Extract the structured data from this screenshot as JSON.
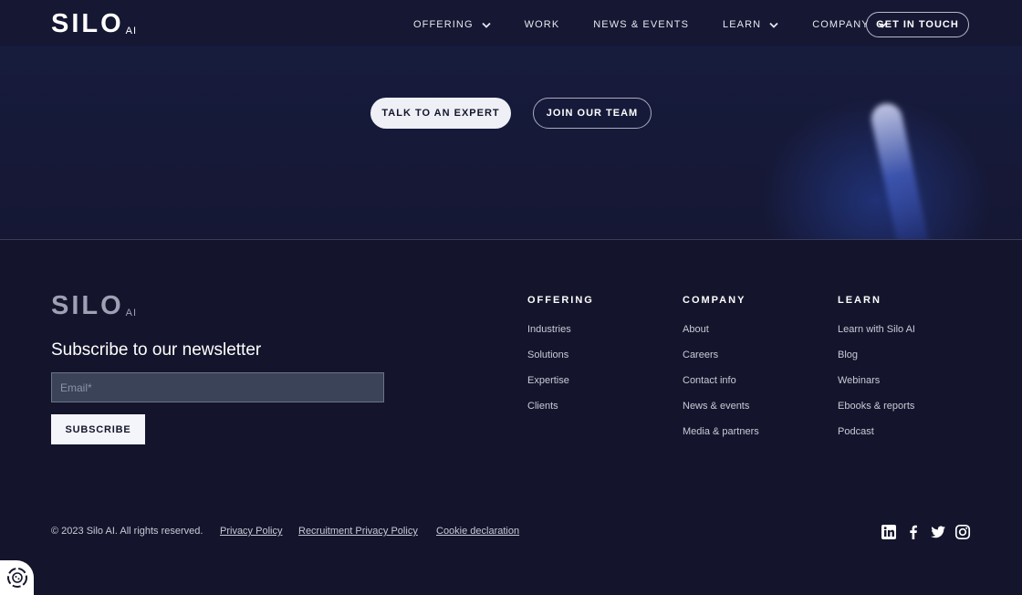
{
  "brand": {
    "name": "SILO",
    "suffix": "AI"
  },
  "nav": {
    "items": [
      {
        "label": "OFFERING",
        "has_dropdown": true
      },
      {
        "label": "WORK",
        "has_dropdown": false
      },
      {
        "label": "NEWS & EVENTS",
        "has_dropdown": false
      },
      {
        "label": "LEARN",
        "has_dropdown": true
      },
      {
        "label": "COMPANY",
        "has_dropdown": true
      }
    ],
    "cta": "GET IN TOUCH"
  },
  "hero": {
    "primary_button": "TALK TO AN EXPERT",
    "secondary_button": "JOIN OUR TEAM"
  },
  "newsletter": {
    "title": "Subscribe to our newsletter",
    "email_placeholder": "Email*",
    "email_value": "",
    "submit_label": "SUBSCRIBE"
  },
  "footer_columns": [
    {
      "heading": "OFFERING",
      "links": [
        "Industries",
        "Solutions",
        "Expertise",
        "Clients"
      ]
    },
    {
      "heading": "COMPANY",
      "links": [
        "About",
        "Careers",
        "Contact info",
        "News & events",
        "Media & partners"
      ]
    },
    {
      "heading": "LEARN",
      "links": [
        "Learn with Silo AI",
        "Blog",
        "Webinars",
        "Ebooks & reports",
        "Podcast"
      ]
    }
  ],
  "legal": {
    "copyright": "© 2023 Silo AI. All rights reserved.",
    "links": [
      "Privacy Policy",
      "Recruitment Privacy Policy",
      "Cookie declaration"
    ]
  },
  "social": [
    "linkedin-icon",
    "facebook-icon",
    "twitter-icon",
    "instagram-icon"
  ],
  "colors": {
    "background": "#14152c",
    "hero": "#151733",
    "accent_glow": "#2846aa"
  }
}
